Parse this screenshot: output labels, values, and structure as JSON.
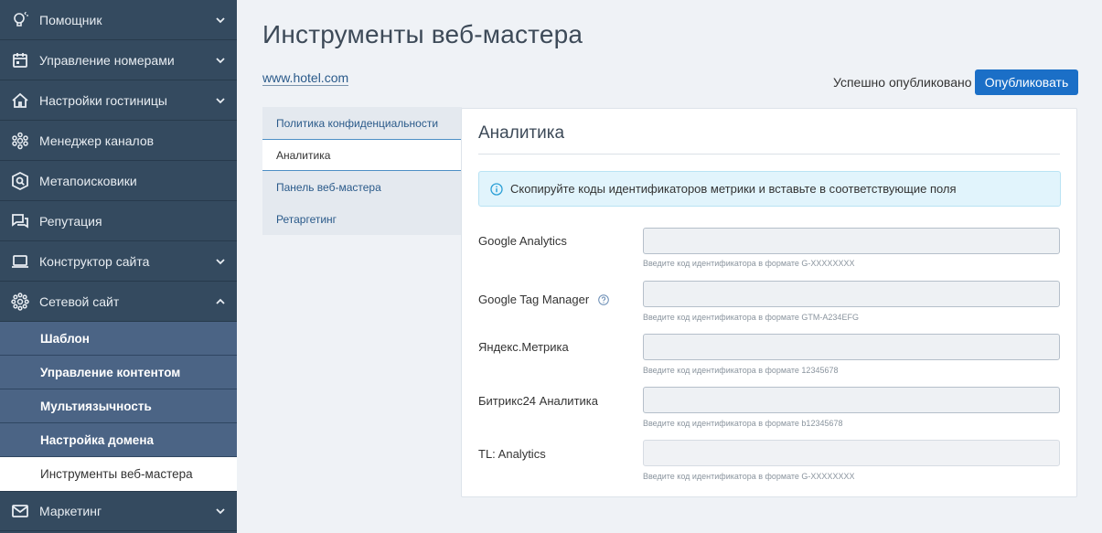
{
  "sidebar": {
    "items": [
      {
        "label": "Помощник",
        "icon": "lightbulb-icon",
        "chevron": "down"
      },
      {
        "label": "Управление номерами",
        "icon": "calendar-icon",
        "chevron": "down"
      },
      {
        "label": "Настройки гостиницы",
        "icon": "home-icon",
        "chevron": "down"
      },
      {
        "label": "Менеджер каналов",
        "icon": "hexagon-network-icon",
        "chevron": null
      },
      {
        "label": "Метапоисковики",
        "icon": "search-badge-icon",
        "chevron": null
      },
      {
        "label": "Репутация",
        "icon": "chat-icon",
        "chevron": null
      },
      {
        "label": "Конструктор сайта",
        "icon": "laptop-icon",
        "chevron": "down"
      },
      {
        "label": "Сетевой сайт",
        "icon": "network-icon",
        "chevron": "up"
      }
    ],
    "subitems": [
      {
        "label": "Шаблон"
      },
      {
        "label": "Управление контентом"
      },
      {
        "label": "Мультиязычность"
      },
      {
        "label": "Настройка домена"
      },
      {
        "label": "Инструменты веб-мастера",
        "active": true
      }
    ],
    "bottom_item": {
      "label": "Маркетинг",
      "icon": "mail-icon",
      "chevron": "down"
    }
  },
  "page": {
    "title": "Инструменты веб-мастера",
    "site_link": "www.hotel.com",
    "publish_status": "Успешно опубликовано",
    "publish_button": "Опубликовать"
  },
  "tabs": [
    {
      "label": "Политика конфиденциальности"
    },
    {
      "label": "Аналитика",
      "active": true
    },
    {
      "label": "Панель веб-мастера"
    },
    {
      "label": "Ретаргетинг"
    }
  ],
  "panel": {
    "title": "Аналитика",
    "info": "Скопируйте коды идентификаторов метрики и вставьте в соответствующие поля",
    "fields": [
      {
        "label": "Google Analytics",
        "value": "",
        "hint": "Введите код идентификатора в формате G-XXXXXXXX"
      },
      {
        "label": "Google Tag Manager",
        "value": "",
        "hint": "Введите код идентификатора в формате GTM-A234EFG",
        "help": true
      },
      {
        "label": "Яндекс.Метрика",
        "value": "",
        "hint": "Введите код идентификатора в формате 12345678"
      },
      {
        "label": "Битрикс24 Аналитика",
        "value": "",
        "hint": "Введите код идентификатора в формате b12345678"
      },
      {
        "label": "TL: Analytics",
        "value": "",
        "hint": "Введите код идентификатора в формате G-XXXXXXXX"
      }
    ]
  },
  "colors": {
    "sidebar_bg": "#344a5f",
    "submenu_bg": "#4b6485",
    "accent": "#1b6fc7",
    "info_bg": "#e1f4fc"
  }
}
